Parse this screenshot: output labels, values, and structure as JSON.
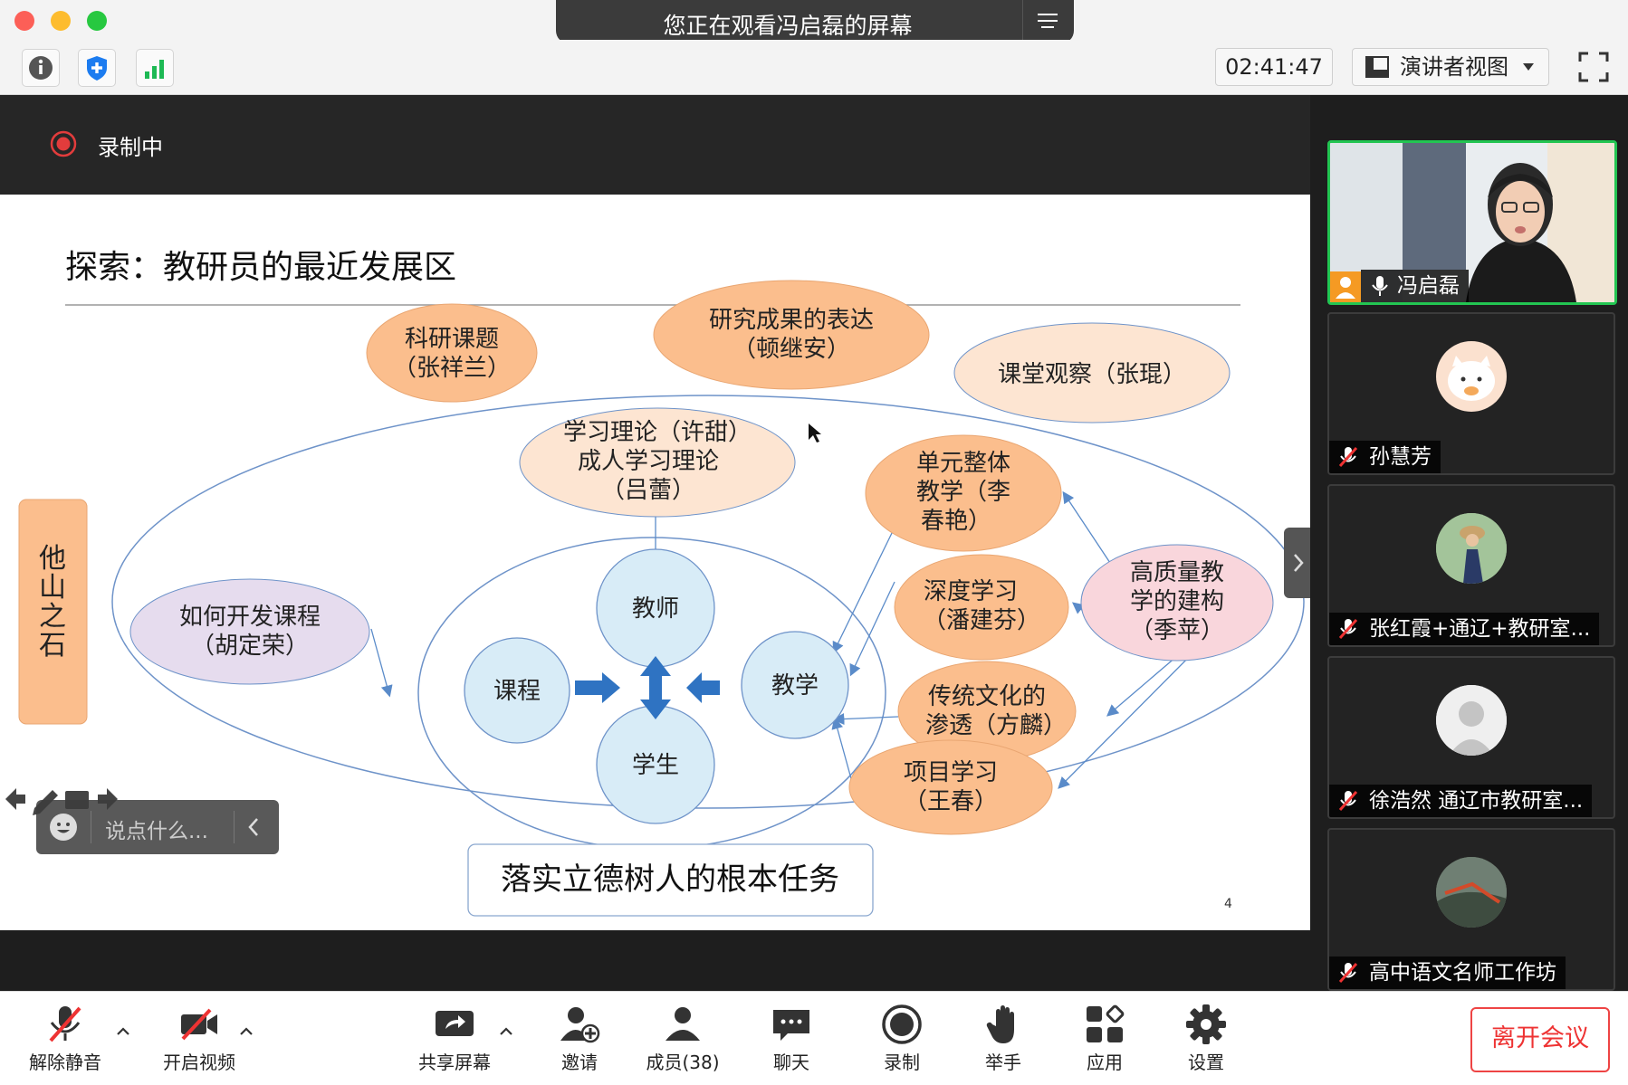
{
  "titlebar": {
    "share_banner": "您正在观看冯启磊的屏幕",
    "colors": {
      "close": "#fc5f57",
      "min": "#fdbc2e",
      "max": "#27c840"
    }
  },
  "toolbar": {
    "icons": [
      "info-icon",
      "shield-icon",
      "signal-icon"
    ],
    "timer": "02:41:47",
    "view_label": "演讲者视图"
  },
  "recording": {
    "label": "录制中"
  },
  "slide": {
    "title": "探索：教研员的最近发展区",
    "nodes": {
      "n1": [
        "科研课题",
        "（张祥兰）"
      ],
      "n2": [
        "研究成果的表达",
        "（顿继安）"
      ],
      "n3": [
        "课堂观察（张琨）"
      ],
      "n4": [
        "学习理论（许甜）",
        "成人学习理论",
        "（吕蕾）"
      ],
      "n5": [
        "单元整体",
        "教学（李",
        "春艳）"
      ],
      "n6": [
        "高质量教",
        "学的建构",
        "（季苹）"
      ],
      "n7": [
        "深度学习",
        "（潘建芬）"
      ],
      "n8": [
        "如何开发课程",
        "（胡定荣）"
      ],
      "n9": [
        "传统文化的",
        "渗透（方麟）"
      ],
      "n10": [
        "项目学习",
        "（王春）"
      ]
    },
    "core": {
      "teacher": "教师",
      "course": "课程",
      "teaching": "教学",
      "student": "学生"
    },
    "side_label": "他山之石",
    "footer_box": "落实立德树人的根本任务",
    "page_number": "4",
    "colors": {
      "orange": "#fbbe8d",
      "light_orange": "#fde5d2",
      "pink": "#f9d6dc",
      "lavender": "#e6dcee",
      "blue_circle": "#d8ecf7",
      "arrow": "#2f73c2"
    }
  },
  "chat": {
    "placeholder": "说点什么..."
  },
  "participants": [
    {
      "name": "冯启磊",
      "video": true,
      "active": true
    },
    {
      "name": "孙慧芳",
      "muted": true
    },
    {
      "name": "张红霞+通辽+教研室...",
      "muted": true
    },
    {
      "name": "徐浩然  通辽市教研室...",
      "muted": true
    },
    {
      "name": "高中语文名师工作坊",
      "muted": true
    }
  ],
  "bottombar": {
    "unmute": "解除静音",
    "video": "开启视频",
    "share": "共享屏幕",
    "invite": "邀请",
    "members": "成员(38)",
    "chat": "聊天",
    "record": "录制",
    "raise_hand": "举手",
    "apps": "应用",
    "settings": "设置",
    "leave": "离开会议"
  }
}
